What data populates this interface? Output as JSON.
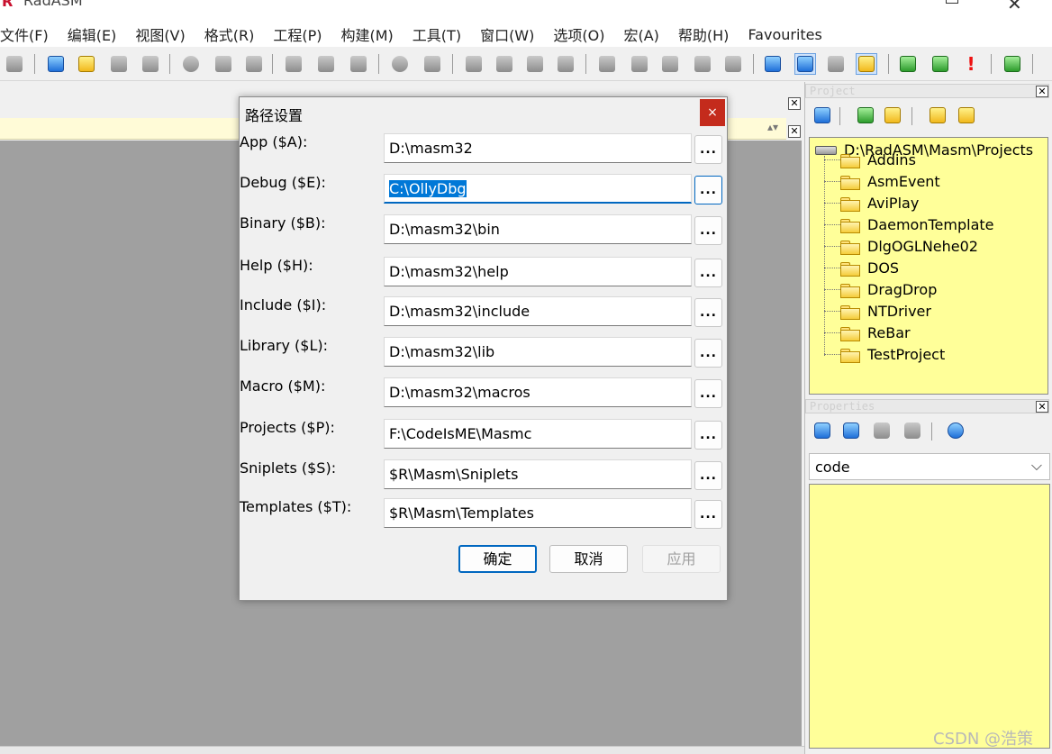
{
  "window": {
    "title": "RadASM",
    "logo": "R"
  },
  "menu": [
    "文件(F)",
    "编辑(E)",
    "视图(V)",
    "格式(R)",
    "工程(P)",
    "构建(M)",
    "工具(T)",
    "窗口(W)",
    "选项(O)",
    "宏(A)",
    "帮助(H)",
    "Favourites"
  ],
  "toolbar": {
    "icons": [
      "print-icon",
      "new-file-icon",
      "open-file-icon",
      "save-icon",
      "save-all-icon",
      "cut-icon",
      "copy-icon",
      "paste-icon",
      "undo-icon",
      "redo-icon",
      "delete-icon",
      "find-icon",
      "replace-icon",
      "toggle-bookmark-icon",
      "next-bookmark-icon",
      "prev-bookmark-icon",
      "clear-bookmarks-icon",
      "block-icon",
      "indent-icon",
      "outdent-icon",
      "comment-icon",
      "uncomment-icon",
      "view-output-icon",
      "view-project-icon",
      "tools-icon",
      "favourite-icon",
      "build-icon",
      "go-icon",
      "error-icon",
      "export-icon"
    ]
  },
  "project_panel": {
    "caption": "Project",
    "root": "D:\\RadASM\\Masm\\Projects",
    "folders": [
      "Addins",
      "AsmEvent",
      "AviPlay",
      "DaemonTemplate",
      "DlgOGLNehe02",
      "DOS",
      "DragDrop",
      "NTDriver",
      "ReBar",
      "TestProject"
    ]
  },
  "properties_panel": {
    "caption": "Properties",
    "selected": "code"
  },
  "dialog": {
    "title": "路径设置",
    "close": "×",
    "browse_label": "...",
    "rows": [
      {
        "label": "App ($A):",
        "value": "D:\\masm32"
      },
      {
        "label": "Debug ($E):",
        "value": "C:\\OllyDbg"
      },
      {
        "label": "Binary ($B):",
        "value": "D:\\masm32\\bin"
      },
      {
        "label": "Help ($H):",
        "value": "D:\\masm32\\help"
      },
      {
        "label": "Include ($I):",
        "value": "D:\\masm32\\include"
      },
      {
        "label": "Library ($L):",
        "value": "D:\\masm32\\lib"
      },
      {
        "label": "Macro ($M):",
        "value": "D:\\masm32\\macros"
      },
      {
        "label": "Projects ($P):",
        "value": "F:\\CodeIsME\\Masmc"
      },
      {
        "label": "Sniplets ($S):",
        "value": "$R\\Masm\\Sniplets"
      },
      {
        "label": "Templates ($T):",
        "value": "$R\\Masm\\Templates"
      }
    ],
    "ok": "确定",
    "cancel": "取消",
    "apply": "应用"
  },
  "watermark": "CSDN @浩策"
}
